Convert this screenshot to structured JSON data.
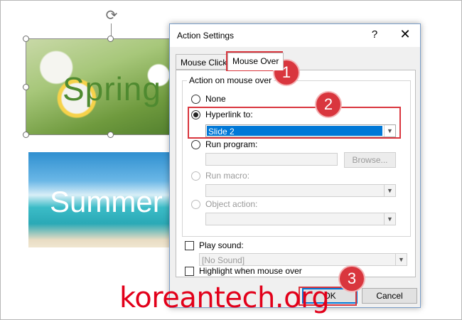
{
  "slides": {
    "spring_label": "Spring",
    "summer_label": "Summer"
  },
  "dialog": {
    "title": "Action Settings",
    "help_glyph": "?",
    "close_glyph": "✕",
    "tabs": [
      "Mouse Click",
      "Mouse Over"
    ],
    "active_tab": "Mouse Over",
    "group_label": "Action on mouse over",
    "options": {
      "none": "None",
      "hyperlink": "Hyperlink to:",
      "run_program": "Run program:",
      "run_macro": "Run macro:",
      "object_action": "Object action:"
    },
    "selected_option": "Hyperlink to:",
    "hyperlink_value": "Slide 2",
    "run_program_value": "",
    "browse_label": "Browse...",
    "play_sound_label": "Play sound:",
    "sound_value": "[No Sound]",
    "highlight_label": "Highlight when mouse over",
    "ok_label": "OK",
    "cancel_label": "Cancel"
  },
  "annotations": [
    "1",
    "2",
    "3"
  ],
  "watermark": "koreantech.org",
  "colors": {
    "annotation_red": "#d9363e",
    "selection_blue": "#0078d7",
    "watermark_red": "#e2001a"
  }
}
